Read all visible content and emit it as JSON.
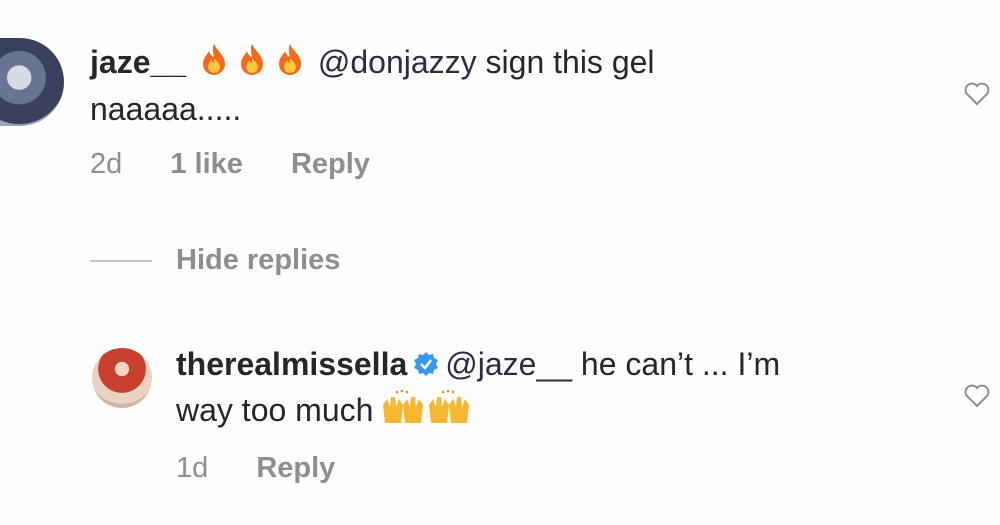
{
  "comments": [
    {
      "username": "jaze__",
      "emoji": "fire-icon x3",
      "mention": "@donjazzy",
      "text_line1": "sign this gel",
      "text_line2": "naaaaa.....",
      "time": "2d",
      "likes": "1 like",
      "reply_label": "Reply"
    },
    {
      "username": "therealmissella",
      "mention": "@jaze__",
      "text_line1": "he can’t ... I’m",
      "text_line2": "way too much",
      "emoji": "raised-hands-icon x2",
      "time": "1d",
      "reply_label": "Reply"
    }
  ],
  "hide_replies_label": "Hide replies",
  "colors": {
    "text": "#262626",
    "meta": "#8e8e8e",
    "verified": "#3897f0",
    "fire_outer": "#f26a1b",
    "fire_inner": "#ffc83d",
    "hands": "#f7b733"
  }
}
